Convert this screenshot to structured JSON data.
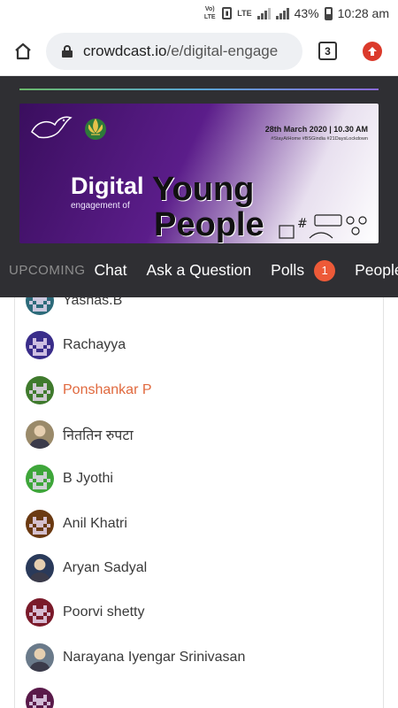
{
  "status_bar": {
    "volte": "Vo) LTE",
    "lte": "LTE",
    "battery": "43%",
    "time": "10:28 am"
  },
  "browser": {
    "url_domain": "crowdcast.io",
    "url_path": "/e/digital-engage",
    "tab_count": "3"
  },
  "banner": {
    "date": "28th March 2020 | 10.30 AM",
    "tags": "#StayAtHome #BSGindia #21DaysLockdown",
    "digital": "Digital",
    "engagement_of": "engagement of",
    "young": "Young",
    "people": "People"
  },
  "tabs": {
    "upcoming": "UPCOMING",
    "chat": "Chat",
    "ask": "Ask a Question",
    "polls": "Polls",
    "polls_count": "1",
    "people": "People"
  },
  "people": [
    {
      "name": "Yashas.B",
      "avatar_color": "#2d6b7a",
      "avatar_pattern": "pixel"
    },
    {
      "name": "Rachayya",
      "avatar_color": "#3a2d8a",
      "avatar_pattern": "pixel"
    },
    {
      "name": "Ponshankar P",
      "avatar_color": "#3f7a2d",
      "avatar_pattern": "pixel",
      "highlight": true
    },
    {
      "name": "निततिन रुपटा",
      "avatar_color": "#9a8a6a",
      "avatar_pattern": "photo"
    },
    {
      "name": "B Jyothi",
      "avatar_color": "#3ea63a",
      "avatar_pattern": "pixel"
    },
    {
      "name": "Anil Khatri",
      "avatar_color": "#6b3a12",
      "avatar_pattern": "pixel"
    },
    {
      "name": "Aryan Sadyal",
      "avatar_color": "#2a3a5a",
      "avatar_pattern": "photo"
    },
    {
      "name": "Poorvi shetty",
      "avatar_color": "#7a1a2a",
      "avatar_pattern": "pixel"
    },
    {
      "name": "Narayana Iyengar Srinivasan",
      "avatar_color": "#6a7a8a",
      "avatar_pattern": "photo"
    },
    {
      "name": "",
      "avatar_color": "#5a1a4a",
      "avatar_pattern": "pixel"
    }
  ]
}
